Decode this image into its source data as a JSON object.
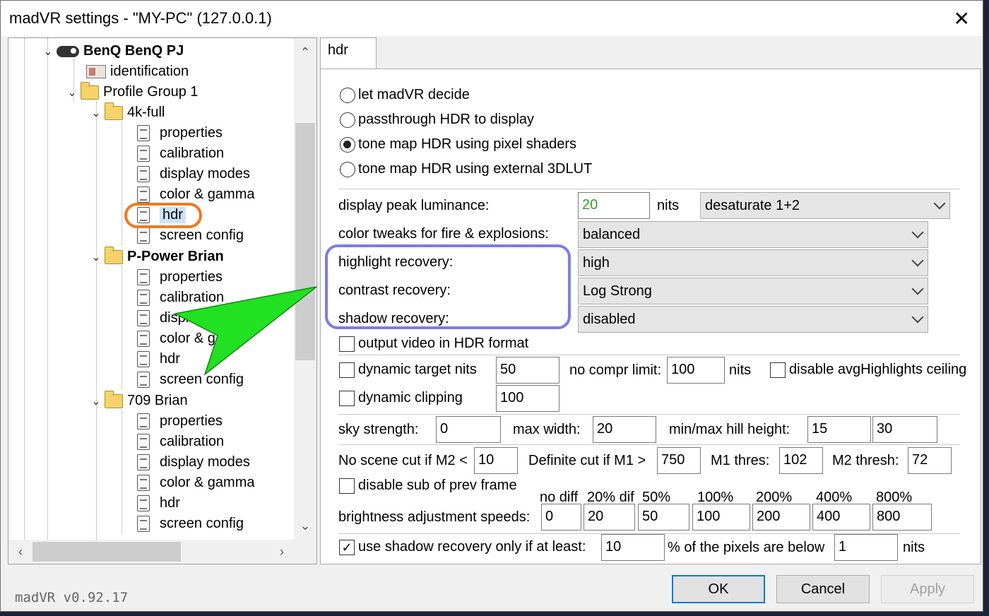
{
  "window": {
    "title": "madVR settings - \"MY-PC\" (127.0.0.1)",
    "close_glyph": "✕"
  },
  "tree": {
    "device": "BenQ BenQ PJ",
    "identification": "identification",
    "profile_group": "Profile Group 1",
    "groups": [
      {
        "name": "4k-full",
        "items": [
          "properties",
          "calibration",
          "display modes",
          "color & gamma",
          "hdr",
          "screen config"
        ]
      },
      {
        "name": "P-Power Brian",
        "items": [
          "properties",
          "calibration",
          "displ",
          "color & g",
          "hdr",
          "screen config"
        ]
      },
      {
        "name": "709 Brian",
        "items": [
          "properties",
          "calibration",
          "display modes",
          "color & gamma",
          "hdr",
          "screen config"
        ]
      }
    ],
    "selected": "hdr"
  },
  "tab": {
    "label": "hdr"
  },
  "hdr": {
    "radios": [
      {
        "label": "let madVR decide",
        "checked": false
      },
      {
        "label": "passthrough HDR to display",
        "checked": false
      },
      {
        "label": "tone map HDR using pixel shaders",
        "checked": true
      },
      {
        "label": "tone map HDR using external 3DLUT",
        "checked": false
      }
    ],
    "peak": {
      "label": "display peak luminance:",
      "value": "20",
      "unit": "nits",
      "mode": "desaturate 1+2"
    },
    "fire": {
      "label": "color tweaks for fire & explosions:",
      "value": "balanced"
    },
    "highlight": {
      "label": "highlight recovery:",
      "value": "high"
    },
    "contrast": {
      "label": "contrast recovery:",
      "value": "Log Strong"
    },
    "shadow": {
      "label": "shadow recovery:",
      "value": "disabled"
    },
    "output_hdr": {
      "label": "output video in HDR format",
      "checked": false
    },
    "dyn_target": {
      "label": "dynamic target nits",
      "value": "50",
      "no_compr_label": "no compr limit:",
      "no_compr_value": "100",
      "unit": "nits",
      "checked": false
    },
    "disable_avg": {
      "label": "disable avgHighlights ceiling",
      "checked": false
    },
    "dyn_clip": {
      "label": "dynamic clipping",
      "value": "100",
      "checked": false
    },
    "sky": {
      "label": "sky strength:",
      "value": "0",
      "max_width_label": "max width:",
      "max_width": "20",
      "hill_label": "min/max hill height:",
      "hill_min": "15",
      "hill_max": "30"
    },
    "scene": {
      "m2_label": "No scene cut if M2 <",
      "m2": "10",
      "m1_label": "Definite cut if M1 >",
      "m1": "750",
      "m1t_label": "M1 thres:",
      "m1t": "102",
      "m2t_label": "M2 thresh:",
      "m2t": "72"
    },
    "disable_sub": {
      "label": "disable sub of prev frame",
      "checked": false
    },
    "speeds": {
      "label": "brightness adjustment speeds:",
      "headers": [
        "no diff",
        "20% dif",
        "50%",
        "100%",
        "200%",
        "400%",
        "800%"
      ],
      "values": [
        "0",
        "20",
        "50",
        "100",
        "200",
        "400",
        "800"
      ]
    },
    "shadow_only": {
      "label": "use shadow recovery only if at least:",
      "value": "10",
      "mid": "% of the pixels are below",
      "value2": "1",
      "unit": "nits",
      "checked": true
    }
  },
  "footer": {
    "version": "madVR v0.92.17",
    "ok": "OK",
    "cancel": "Cancel",
    "apply": "Apply"
  },
  "colors": {
    "highlight_ring": "#7c7ce8",
    "selected_ring": "#f07a1e",
    "arrow": "#22e022"
  }
}
